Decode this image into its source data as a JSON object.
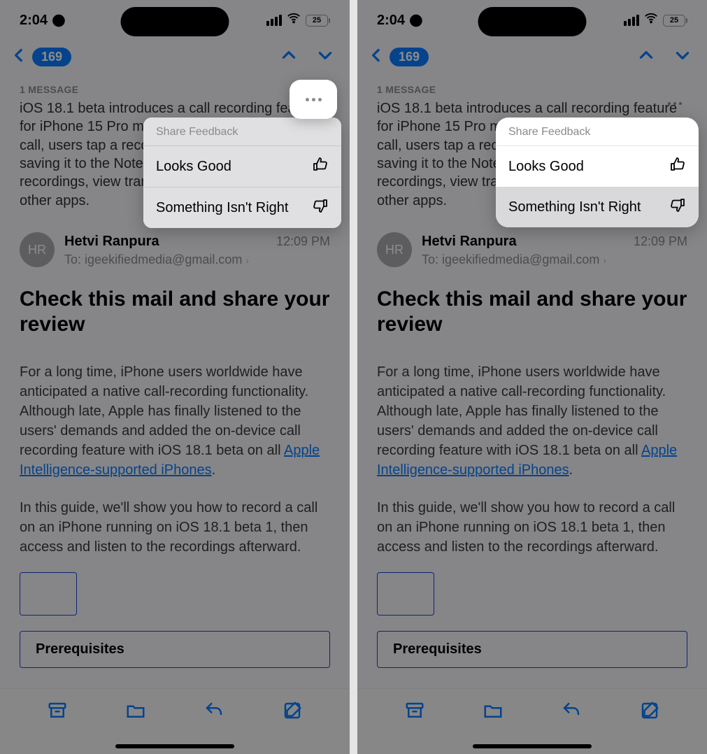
{
  "status": {
    "time": "2:04",
    "battery_pct": "25"
  },
  "nav": {
    "badge": "169"
  },
  "mail": {
    "message_count_label": "1 MESSAGE",
    "summary": "iOS 18.1 beta introduces a call recording feature for iPhone 15 Pro models in the US. To record a call, users tap a record button during a call, saving it to the Notes app. Users can listen to recordings, view transcripts, or share them with other apps.",
    "sender_initials": "HR",
    "sender_name": "Hetvi Ranpura",
    "time": "12:09 PM",
    "to_label": "To:",
    "to_address": "igeekifiedmedia@gmail.com",
    "subject": "Check this mail and share your review",
    "body_p1_a": "For a long time, iPhone users worldwide have anticipated a native call-recording functionality. Although late, Apple has finally listened to the users' demands and added the on-device call recording feature with iOS 18.1 beta on all ",
    "body_p1_link": "Apple Intelligence-supported iPhones",
    "body_p1_b": ".",
    "body_p2": "In this guide, we'll show you how to record a call on an iPhone running on iOS 18.1 beta 1, then access and listen to the recordings afterward.",
    "prereq_title": "Prerequisites"
  },
  "popover": {
    "header": "Share Feedback",
    "option_good": "Looks Good",
    "option_bad": "Something Isn't Right"
  }
}
